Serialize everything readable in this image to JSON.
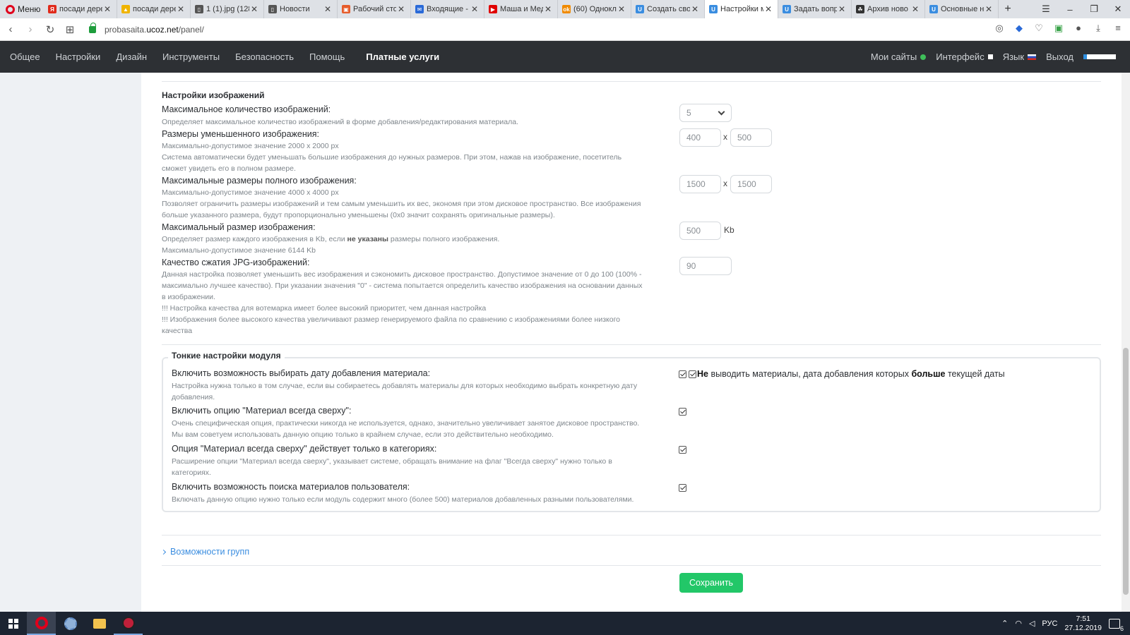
{
  "browser": {
    "menu_label": "Меню",
    "tabs": [
      {
        "title": "посади дере",
        "fav_color": "#e02a1b",
        "fav_glyph": "Я"
      },
      {
        "title": "посади дере",
        "fav_color": "#f0b400",
        "fav_glyph": "▲"
      },
      {
        "title": "1 (1).jpg (128",
        "fav_color": "#555",
        "fav_glyph": "▯"
      },
      {
        "title": "Новости",
        "fav_color": "#555",
        "fav_glyph": "▯"
      },
      {
        "title": "Рабочий сто",
        "fav_color": "#e65c2b",
        "fav_glyph": "▣"
      },
      {
        "title": "Входящие - ",
        "fav_color": "#2a6ad8",
        "fav_glyph": "✉"
      },
      {
        "title": "Маша и Мед",
        "fav_color": "#e00000",
        "fav_glyph": "▶"
      },
      {
        "title": "(60) Однокл",
        "fav_color": "#f08a00",
        "fav_glyph": "ok"
      },
      {
        "title": "Создать сво",
        "fav_color": "#3a8de0",
        "fav_glyph": "U"
      },
      {
        "title": "Настройки м",
        "fav_color": "#3a8de0",
        "fav_glyph": "U",
        "active": true
      },
      {
        "title": "Задать вопр",
        "fav_color": "#3a8de0",
        "fav_glyph": "U"
      },
      {
        "title": "Архив ново",
        "fav_color": "#333",
        "fav_glyph": "☘"
      },
      {
        "title": "Основные н",
        "fav_color": "#3a8de0",
        "fav_glyph": "U"
      }
    ],
    "url_prefix": "probasaita.",
    "url_domain": "ucoz.net",
    "url_path": "/panel/"
  },
  "nav": {
    "items": [
      "Общее",
      "Настройки",
      "Дизайн",
      "Инструменты",
      "Безопасность",
      "Помощь"
    ],
    "paid": "Платные услуги",
    "right": {
      "my_sites": "Мои сайты",
      "interface": "Интерфейс",
      "language": "Язык",
      "logout": "Выход"
    }
  },
  "images_section": {
    "title": "Настройки изображений",
    "max_count": {
      "label": "Максимальное количество изображений:",
      "desc": "Определяет максимальное количество изображений в форме добавления/редактирования материала.",
      "value": "5"
    },
    "thumb_size": {
      "label": "Размеры уменьшенного изображения:",
      "desc1": "Максимально-допустимое значение 2000 x 2000 px",
      "desc2": "Система автоматически будет уменьшать большие изображения до нужных размеров. При этом, нажав на изображение, посетитель",
      "desc3": "сможет увидеть его в полном размере.",
      "width": "400",
      "height": "500",
      "times": "x"
    },
    "full_size": {
      "label": "Максимальные размеры полного изображения:",
      "desc1": "Максимально-допустимое значение 4000 x 4000 px",
      "desc2": "Позволяет ограничить размеры изображений и тем самым уменьшить их вес, экономя при этом дисковое пространство. Все изображения",
      "desc3": "больше указанного размера, будут пропорционально уменьшены (0x0 значит сохранять оригинальные размеры).",
      "width": "1500",
      "height": "1500",
      "times": "x"
    },
    "max_weight": {
      "label": "Максимальный размер изображения:",
      "desc_pre": "Определяет размер каждого изображения в Kb, если ",
      "desc_bold": "не указаны",
      "desc_post": " размеры полного изображения.",
      "desc2": "Максимально-допустимое значение 6144 Kb",
      "value": "500",
      "unit": "Kb"
    },
    "jpg_quality": {
      "label": "Качество сжатия JPG-изображений:",
      "desc1": "Данная настройка позволяет уменьшить вес изображения и сэкономить дисковое пространство. Допустимое значение от 0 до 100 (100% -",
      "desc2": "максимально лучшее качество). При указании значения \"0\" - система попытается определить качество изображения на основании данных",
      "desc3": "в изображении.",
      "desc4": "!!! Настройка качества для вотемарка имеет более высокий приоритет, чем данная настройка",
      "desc5": "!!! Изображения более высокого качества увеличивают размер генерируемого файла по сравнению с изображениями более низкого",
      "desc6": "качества",
      "value": "90"
    }
  },
  "fine": {
    "legend": "Тонкие настройки модуля",
    "date_choice": {
      "label": "Включить возможность выбирать дату добавления материала:",
      "desc1": "Настройка нужна только в том случае, если вы собираетесь добавлять материалы для которых необходимо выбрать конкретную дату",
      "desc2": "добавления.",
      "extra_pre": "Не",
      "extra_mid": " выводить материалы, дата добавления которых ",
      "extra_bold": "больше",
      "extra_post": " текущей даты"
    },
    "always_top": {
      "label": "Включить опцию \"Материал всегда сверху\":",
      "desc1": "Очень специфическая опция, практически никогда не используется, однако, значительно увеличивает занятое дисковое пространство.",
      "desc2": "Мы вам советуем использовать данную опцию только в крайнем случае, если это действительно необходимо."
    },
    "top_in_categories": {
      "label": "Опция \"Материал всегда сверху\" действует только в категориях:",
      "desc1": "Расширение опции \"Материал всегда сверху\", указывает системе, обращать внимание на флаг \"Всегда сверху\" нужно только в",
      "desc2": "категориях."
    },
    "user_search": {
      "label": "Включить возможность поиска материалов пользователя:",
      "desc1": "Включать данную опцию нужно только если модуль содержит много (более 500) материалов добавленных разными пользователями."
    }
  },
  "groups_link": "Возможности групп",
  "save_label": "Сохранить",
  "taskbar": {
    "lang": "РУС",
    "time": "7:51",
    "date": "27.12.2019",
    "notif_count": "6"
  }
}
